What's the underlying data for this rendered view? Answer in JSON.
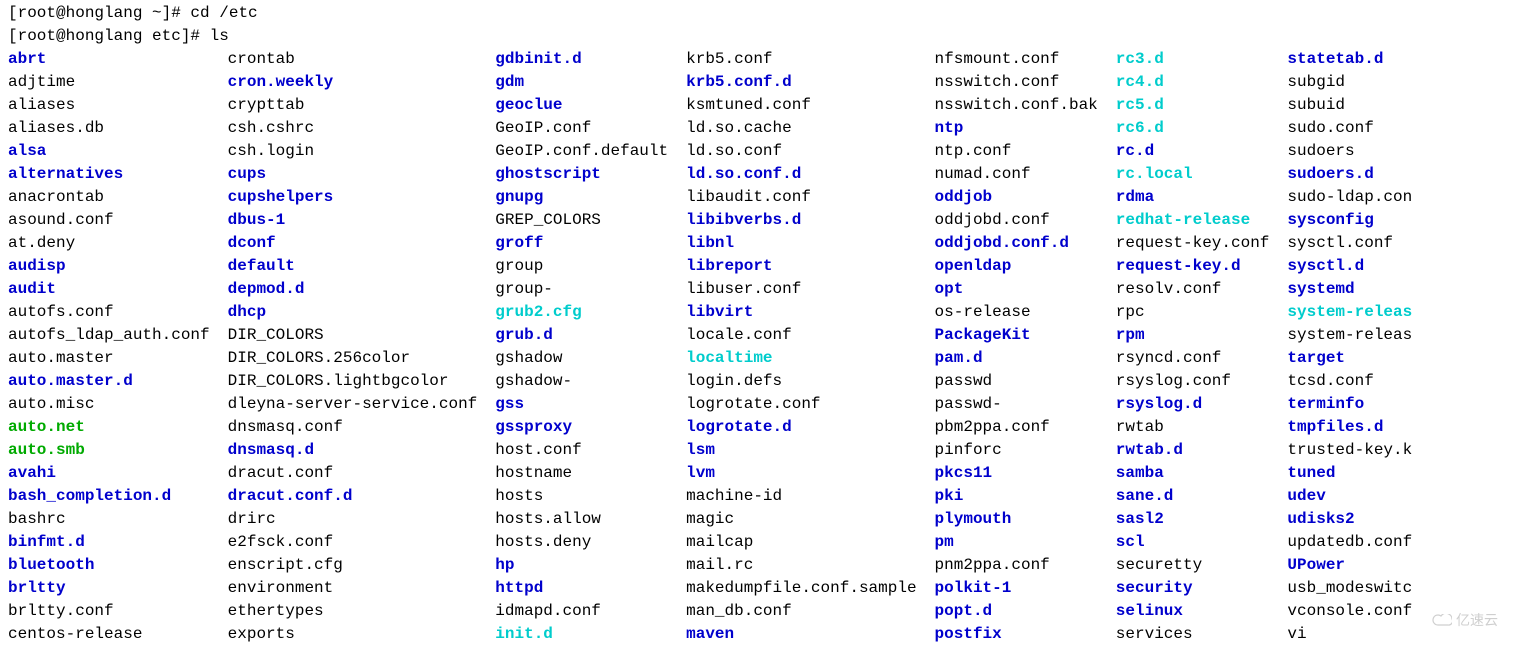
{
  "prompt1": "[root@honglang ~]# cd /etc",
  "prompt2": "[root@honglang etc]# ls",
  "watermark": "亿速云",
  "columns": [
    [
      {
        "t": "abrt",
        "c": "dir"
      },
      {
        "t": "adjtime",
        "c": "plain"
      },
      {
        "t": "aliases",
        "c": "plain"
      },
      {
        "t": "aliases.db",
        "c": "plain"
      },
      {
        "t": "alsa",
        "c": "dir"
      },
      {
        "t": "alternatives",
        "c": "dir"
      },
      {
        "t": "anacrontab",
        "c": "plain"
      },
      {
        "t": "asound.conf",
        "c": "plain"
      },
      {
        "t": "at.deny",
        "c": "plain"
      },
      {
        "t": "audisp",
        "c": "dir"
      },
      {
        "t": "audit",
        "c": "dir"
      },
      {
        "t": "autofs.conf",
        "c": "plain"
      },
      {
        "t": "autofs_ldap_auth.conf",
        "c": "plain"
      },
      {
        "t": "auto.master",
        "c": "plain"
      },
      {
        "t": "auto.master.d",
        "c": "dir"
      },
      {
        "t": "auto.misc",
        "c": "plain"
      },
      {
        "t": "auto.net",
        "c": "exec"
      },
      {
        "t": "auto.smb",
        "c": "exec"
      },
      {
        "t": "avahi",
        "c": "dir"
      },
      {
        "t": "bash_completion.d",
        "c": "dir"
      },
      {
        "t": "bashrc",
        "c": "plain"
      },
      {
        "t": "binfmt.d",
        "c": "dir"
      },
      {
        "t": "bluetooth",
        "c": "dir"
      },
      {
        "t": "brltty",
        "c": "dir"
      },
      {
        "t": "brltty.conf",
        "c": "plain"
      },
      {
        "t": "centos-release",
        "c": "plain"
      }
    ],
    [
      {
        "t": "crontab",
        "c": "plain"
      },
      {
        "t": "cron.weekly",
        "c": "dir"
      },
      {
        "t": "crypttab",
        "c": "plain"
      },
      {
        "t": "csh.cshrc",
        "c": "plain"
      },
      {
        "t": "csh.login",
        "c": "plain"
      },
      {
        "t": "cups",
        "c": "dir"
      },
      {
        "t": "cupshelpers",
        "c": "dir"
      },
      {
        "t": "dbus-1",
        "c": "dir"
      },
      {
        "t": "dconf",
        "c": "dir"
      },
      {
        "t": "default",
        "c": "dir"
      },
      {
        "t": "depmod.d",
        "c": "dir"
      },
      {
        "t": "dhcp",
        "c": "dir"
      },
      {
        "t": "DIR_COLORS",
        "c": "plain"
      },
      {
        "t": "DIR_COLORS.256color",
        "c": "plain"
      },
      {
        "t": "DIR_COLORS.lightbgcolor",
        "c": "plain"
      },
      {
        "t": "dleyna-server-service.conf",
        "c": "plain"
      },
      {
        "t": "dnsmasq.conf",
        "c": "plain"
      },
      {
        "t": "dnsmasq.d",
        "c": "dir"
      },
      {
        "t": "dracut.conf",
        "c": "plain"
      },
      {
        "t": "dracut.conf.d",
        "c": "dir"
      },
      {
        "t": "drirc",
        "c": "plain"
      },
      {
        "t": "e2fsck.conf",
        "c": "plain"
      },
      {
        "t": "enscript.cfg",
        "c": "plain"
      },
      {
        "t": "environment",
        "c": "plain"
      },
      {
        "t": "ethertypes",
        "c": "plain"
      },
      {
        "t": "exports",
        "c": "plain"
      }
    ],
    [
      {
        "t": "gdbinit.d",
        "c": "dir"
      },
      {
        "t": "gdm",
        "c": "dir"
      },
      {
        "t": "geoclue",
        "c": "dir"
      },
      {
        "t": "GeoIP.conf",
        "c": "plain"
      },
      {
        "t": "GeoIP.conf.default",
        "c": "plain"
      },
      {
        "t": "ghostscript",
        "c": "dir"
      },
      {
        "t": "gnupg",
        "c": "dir"
      },
      {
        "t": "GREP_COLORS",
        "c": "plain"
      },
      {
        "t": "groff",
        "c": "dir"
      },
      {
        "t": "group",
        "c": "plain"
      },
      {
        "t": "group-",
        "c": "plain"
      },
      {
        "t": "grub2.cfg",
        "c": "link"
      },
      {
        "t": "grub.d",
        "c": "dir"
      },
      {
        "t": "gshadow",
        "c": "plain"
      },
      {
        "t": "gshadow-",
        "c": "plain"
      },
      {
        "t": "gss",
        "c": "dir"
      },
      {
        "t": "gssproxy",
        "c": "dir"
      },
      {
        "t": "host.conf",
        "c": "plain"
      },
      {
        "t": "hostname",
        "c": "plain"
      },
      {
        "t": "hosts",
        "c": "plain"
      },
      {
        "t": "hosts.allow",
        "c": "plain"
      },
      {
        "t": "hosts.deny",
        "c": "plain"
      },
      {
        "t": "hp",
        "c": "dir"
      },
      {
        "t": "httpd",
        "c": "dir"
      },
      {
        "t": "idmapd.conf",
        "c": "plain"
      },
      {
        "t": "init.d",
        "c": "link"
      }
    ],
    [
      {
        "t": "krb5.conf",
        "c": "plain"
      },
      {
        "t": "krb5.conf.d",
        "c": "dir"
      },
      {
        "t": "ksmtuned.conf",
        "c": "plain"
      },
      {
        "t": "ld.so.cache",
        "c": "plain"
      },
      {
        "t": "ld.so.conf",
        "c": "plain"
      },
      {
        "t": "ld.so.conf.d",
        "c": "dir"
      },
      {
        "t": "libaudit.conf",
        "c": "plain"
      },
      {
        "t": "libibverbs.d",
        "c": "dir"
      },
      {
        "t": "libnl",
        "c": "dir"
      },
      {
        "t": "libreport",
        "c": "dir"
      },
      {
        "t": "libuser.conf",
        "c": "plain"
      },
      {
        "t": "libvirt",
        "c": "dir"
      },
      {
        "t": "locale.conf",
        "c": "plain"
      },
      {
        "t": "localtime",
        "c": "link"
      },
      {
        "t": "login.defs",
        "c": "plain"
      },
      {
        "t": "logrotate.conf",
        "c": "plain"
      },
      {
        "t": "logrotate.d",
        "c": "dir"
      },
      {
        "t": "lsm",
        "c": "dir"
      },
      {
        "t": "lvm",
        "c": "dir"
      },
      {
        "t": "machine-id",
        "c": "plain"
      },
      {
        "t": "magic",
        "c": "plain"
      },
      {
        "t": "mailcap",
        "c": "plain"
      },
      {
        "t": "mail.rc",
        "c": "plain"
      },
      {
        "t": "makedumpfile.conf.sample",
        "c": "plain"
      },
      {
        "t": "man_db.conf",
        "c": "plain"
      },
      {
        "t": "maven",
        "c": "dir"
      }
    ],
    [
      {
        "t": "nfsmount.conf",
        "c": "plain"
      },
      {
        "t": "nsswitch.conf",
        "c": "plain"
      },
      {
        "t": "nsswitch.conf.bak",
        "c": "plain"
      },
      {
        "t": "ntp",
        "c": "dir"
      },
      {
        "t": "ntp.conf",
        "c": "plain"
      },
      {
        "t": "numad.conf",
        "c": "plain"
      },
      {
        "t": "oddjob",
        "c": "dir"
      },
      {
        "t": "oddjobd.conf",
        "c": "plain"
      },
      {
        "t": "oddjobd.conf.d",
        "c": "dir"
      },
      {
        "t": "openldap",
        "c": "dir"
      },
      {
        "t": "opt",
        "c": "dir"
      },
      {
        "t": "os-release",
        "c": "plain"
      },
      {
        "t": "PackageKit",
        "c": "dir"
      },
      {
        "t": "pam.d",
        "c": "dir"
      },
      {
        "t": "passwd",
        "c": "plain"
      },
      {
        "t": "passwd-",
        "c": "plain"
      },
      {
        "t": "pbm2ppa.conf",
        "c": "plain"
      },
      {
        "t": "pinforc",
        "c": "plain"
      },
      {
        "t": "pkcs11",
        "c": "dir"
      },
      {
        "t": "pki",
        "c": "dir"
      },
      {
        "t": "plymouth",
        "c": "dir"
      },
      {
        "t": "pm",
        "c": "dir"
      },
      {
        "t": "pnm2ppa.conf",
        "c": "plain"
      },
      {
        "t": "polkit-1",
        "c": "dir"
      },
      {
        "t": "popt.d",
        "c": "dir"
      },
      {
        "t": "postfix",
        "c": "dir"
      }
    ],
    [
      {
        "t": "rc3.d",
        "c": "link"
      },
      {
        "t": "rc4.d",
        "c": "link"
      },
      {
        "t": "rc5.d",
        "c": "link"
      },
      {
        "t": "rc6.d",
        "c": "link"
      },
      {
        "t": "rc.d",
        "c": "dir"
      },
      {
        "t": "rc.local",
        "c": "link"
      },
      {
        "t": "rdma",
        "c": "dir"
      },
      {
        "t": "redhat-release",
        "c": "link"
      },
      {
        "t": "request-key.conf",
        "c": "plain"
      },
      {
        "t": "request-key.d",
        "c": "dir"
      },
      {
        "t": "resolv.conf",
        "c": "plain"
      },
      {
        "t": "rpc",
        "c": "plain"
      },
      {
        "t": "rpm",
        "c": "dir"
      },
      {
        "t": "rsyncd.conf",
        "c": "plain"
      },
      {
        "t": "rsyslog.conf",
        "c": "plain"
      },
      {
        "t": "rsyslog.d",
        "c": "dir"
      },
      {
        "t": "rwtab",
        "c": "plain"
      },
      {
        "t": "rwtab.d",
        "c": "dir"
      },
      {
        "t": "samba",
        "c": "dir"
      },
      {
        "t": "sane.d",
        "c": "dir"
      },
      {
        "t": "sasl2",
        "c": "dir"
      },
      {
        "t": "scl",
        "c": "dir"
      },
      {
        "t": "securetty",
        "c": "plain"
      },
      {
        "t": "security",
        "c": "dir"
      },
      {
        "t": "selinux",
        "c": "dir"
      },
      {
        "t": "services",
        "c": "plain"
      }
    ],
    [
      {
        "t": "statetab.d",
        "c": "dir"
      },
      {
        "t": "subgid",
        "c": "plain"
      },
      {
        "t": "subuid",
        "c": "plain"
      },
      {
        "t": "sudo.conf",
        "c": "plain"
      },
      {
        "t": "sudoers",
        "c": "plain"
      },
      {
        "t": "sudoers.d",
        "c": "dir"
      },
      {
        "t": "sudo-ldap.con",
        "c": "plain"
      },
      {
        "t": "sysconfig",
        "c": "dir"
      },
      {
        "t": "sysctl.conf",
        "c": "plain"
      },
      {
        "t": "sysctl.d",
        "c": "dir"
      },
      {
        "t": "systemd",
        "c": "dir"
      },
      {
        "t": "system-releas",
        "c": "link"
      },
      {
        "t": "system-releas",
        "c": "plain"
      },
      {
        "t": "target",
        "c": "dir"
      },
      {
        "t": "tcsd.conf",
        "c": "plain"
      },
      {
        "t": "terminfo",
        "c": "dir"
      },
      {
        "t": "tmpfiles.d",
        "c": "dir"
      },
      {
        "t": "trusted-key.k",
        "c": "plain"
      },
      {
        "t": "tuned",
        "c": "dir"
      },
      {
        "t": "udev",
        "c": "dir"
      },
      {
        "t": "udisks2",
        "c": "dir"
      },
      {
        "t": "updatedb.conf",
        "c": "plain"
      },
      {
        "t": "UPower",
        "c": "dir"
      },
      {
        "t": "usb_modeswitc",
        "c": "plain"
      },
      {
        "t": "vconsole.conf",
        "c": "plain"
      },
      {
        "t": "vi",
        "c": "plain"
      }
    ]
  ]
}
